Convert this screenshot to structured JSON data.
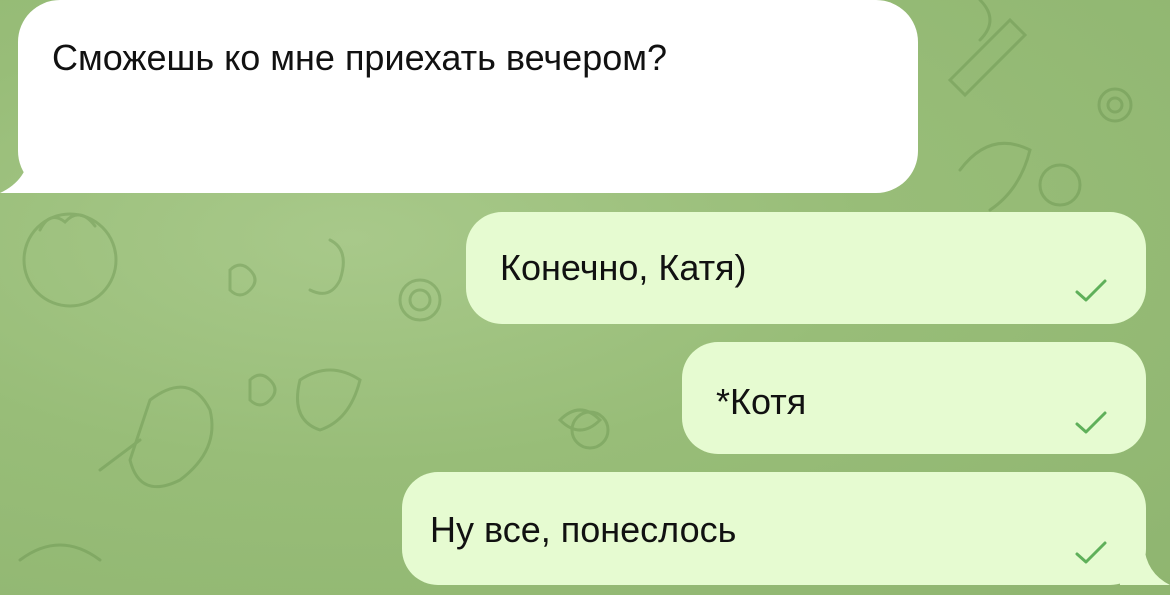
{
  "chat": {
    "incoming": [
      {
        "text": "Сможешь ко мне приехать вечером?"
      }
    ],
    "outgoing": [
      {
        "text": "Конечно, Катя)",
        "status_icon": "single-check-icon"
      },
      {
        "text": "*Котя",
        "status_icon": "single-check-icon"
      },
      {
        "text": "Ну все, понеслось",
        "status_icon": "single-check-icon"
      }
    ]
  },
  "colors": {
    "wallpaper": "#98bd78",
    "incoming_bubble": "#ffffff",
    "outgoing_bubble": "#e6fbd1",
    "check": "#5fb05a",
    "text": "#111111"
  }
}
